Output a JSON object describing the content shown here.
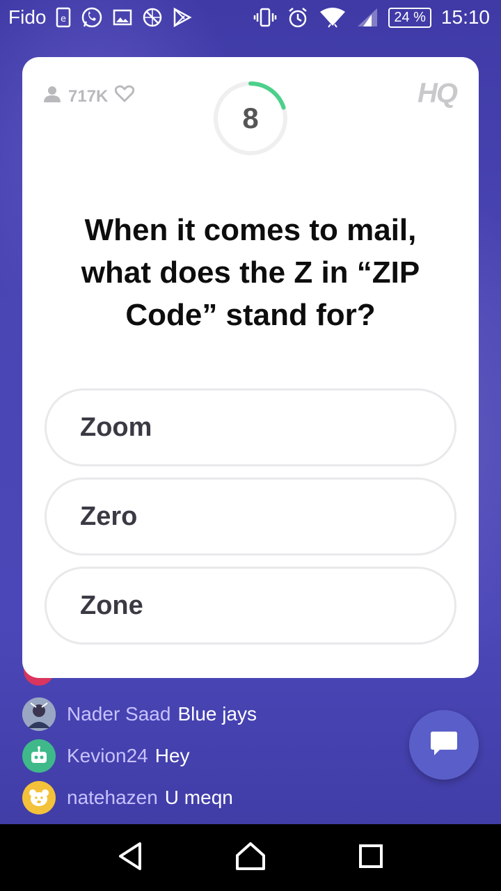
{
  "status_bar": {
    "carrier": "Fido",
    "battery": "24 %",
    "time": "15:10",
    "icons": [
      "sim-icon",
      "whatsapp-icon",
      "gallery-icon",
      "blocked-app-icon",
      "play-store-icon",
      "vibrate-icon",
      "alarm-icon",
      "wifi-icon",
      "signal-icon"
    ]
  },
  "card": {
    "viewer_count": "717K",
    "timer_value": "8",
    "timer_progress": 0.2,
    "logo": "HQ",
    "question": "When it comes to mail, what does the Z in “ZIP Code” stand for?",
    "options": [
      "Zoom",
      "Zero",
      "Zone"
    ]
  },
  "chat": {
    "messages": [
      {
        "user": "Nader Saad",
        "text": "Blue jays",
        "avatar": "photo-avatar"
      },
      {
        "user": "Kevion24",
        "text": "Hey",
        "avatar": "robot-avatar"
      },
      {
        "user": "natehazen",
        "text": "U meqn",
        "avatar": "bear-avatar"
      }
    ]
  },
  "colors": {
    "accent_green": "#4cd08a",
    "background_purple": "#4a46b4",
    "chat_username": "#c7c2ff",
    "fab": "#5a5ec9"
  }
}
